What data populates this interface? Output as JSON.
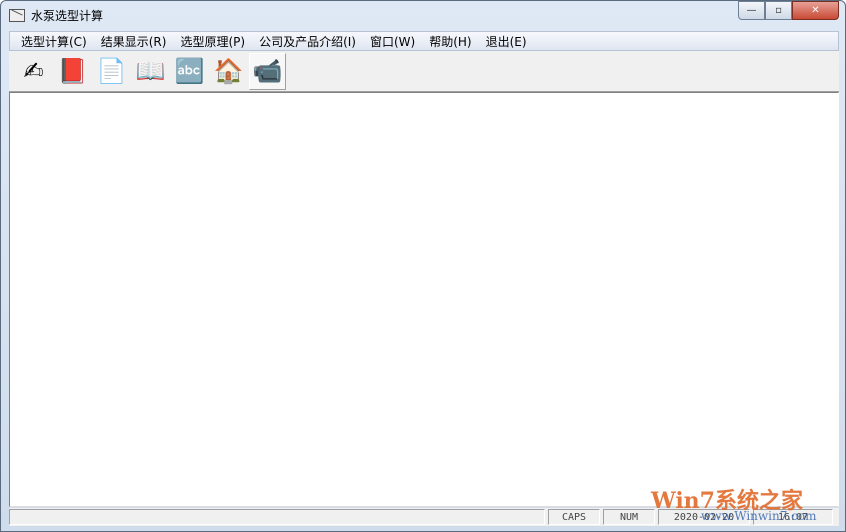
{
  "window": {
    "title": "水泵选型计算",
    "minimize": "—",
    "maximize": "▫",
    "close": "✕"
  },
  "menu": [
    {
      "label": "选型计算(C)"
    },
    {
      "label": "结果显示(R)"
    },
    {
      "label": "选型原理(P)"
    },
    {
      "label": "公司及产品介绍(I)"
    },
    {
      "label": "窗口(W)"
    },
    {
      "label": "帮助(H)"
    },
    {
      "label": "退出(E)"
    }
  ],
  "toolbar": [
    {
      "icon": "hand-writing-icon",
      "glyph": "✍"
    },
    {
      "icon": "book-pen-icon",
      "glyph": "📕"
    },
    {
      "icon": "notepad-icon",
      "glyph": "📄"
    },
    {
      "icon": "open-book-icon",
      "glyph": "📖"
    },
    {
      "icon": "abc-123-icon",
      "glyph": "🔤"
    },
    {
      "icon": "house-car-icon",
      "glyph": "🏠"
    },
    {
      "icon": "video-camera-man-icon",
      "glyph": "📹"
    }
  ],
  "status": {
    "message": "",
    "caps": "CAPS",
    "num": "NUM",
    "date": "2020-02-20",
    "time": "16:07"
  },
  "watermark": {
    "brand": "Win7系统之家",
    "url": "www.Winwin7.com"
  }
}
